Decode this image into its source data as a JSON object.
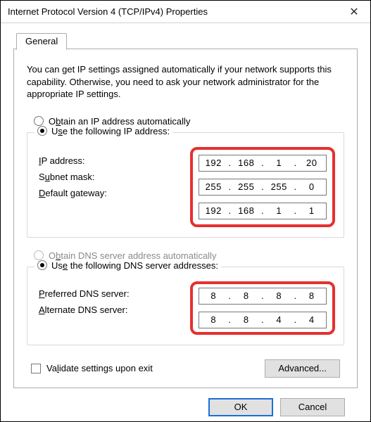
{
  "window": {
    "title": "Internet Protocol Version 4 (TCP/IPv4) Properties",
    "close_glyph": "✕"
  },
  "tab": {
    "label": "General"
  },
  "intro": "You can get IP settings assigned automatically if your network supports this capability. Otherwise, you need to ask your network administrator for the appropriate IP settings.",
  "ip": {
    "auto": {
      "label_pre": "O",
      "label_hot": "b",
      "label_post": "tain an IP address automatically",
      "selected": false,
      "disabled": false
    },
    "manual": {
      "label_pre": "U",
      "label_hot": "s",
      "label_post": "e the following IP address:",
      "selected": true
    },
    "fields": {
      "ip": {
        "label_pre": "",
        "label_hot": "I",
        "label_post": "P address:",
        "o1": "192",
        "o2": "168",
        "o3": "1",
        "o4": "20"
      },
      "subnet": {
        "label_pre": "S",
        "label_hot": "u",
        "label_post": "bnet mask:",
        "o1": "255",
        "o2": "255",
        "o3": "255",
        "o4": "0"
      },
      "gateway": {
        "label_pre": "",
        "label_hot": "D",
        "label_post": "efault gateway:",
        "o1": "192",
        "o2": "168",
        "o3": "1",
        "o4": "1"
      }
    }
  },
  "dns": {
    "auto": {
      "label_pre": "O",
      "label_hot": "b",
      "label_post": "tain DNS server address automatically",
      "selected": false,
      "disabled": true
    },
    "manual": {
      "label_pre": "Us",
      "label_hot": "e",
      "label_post": " the following DNS server addresses:",
      "selected": true
    },
    "fields": {
      "preferred": {
        "label_pre": "",
        "label_hot": "P",
        "label_post": "referred DNS server:",
        "o1": "8",
        "o2": "8",
        "o3": "8",
        "o4": "8"
      },
      "alternate": {
        "label_pre": "",
        "label_hot": "A",
        "label_post": "lternate DNS server:",
        "o1": "8",
        "o2": "8",
        "o3": "4",
        "o4": "4"
      }
    }
  },
  "validate": {
    "label_pre": "Va",
    "label_hot": "l",
    "label_post": "idate settings upon exit",
    "checked": false
  },
  "buttons": {
    "advanced": "Advanced...",
    "ok": "OK",
    "cancel": "Cancel"
  },
  "dot": "."
}
